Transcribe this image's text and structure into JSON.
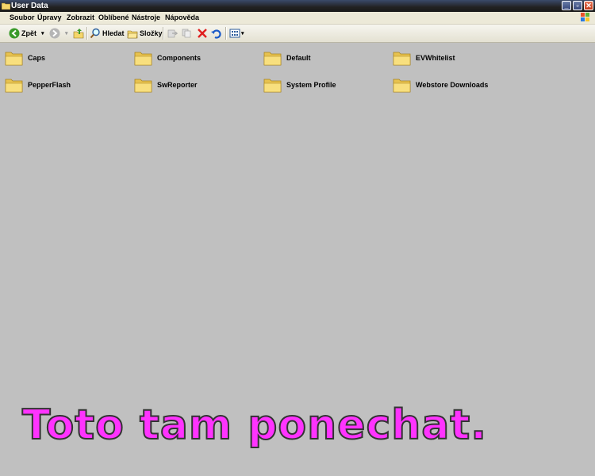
{
  "window": {
    "title": "User Data"
  },
  "menu": [
    "Soubor",
    "Úpravy",
    "Zobrazit",
    "Oblíbené",
    "Nástroje",
    "Nápověda"
  ],
  "toolbar": {
    "back_label": "Zpět",
    "search_label": "Hledat",
    "folders_label": "Složky"
  },
  "folders": [
    {
      "name": "Caps"
    },
    {
      "name": "Components"
    },
    {
      "name": "Default"
    },
    {
      "name": "EVWhitelist"
    },
    {
      "name": "PepperFlash"
    },
    {
      "name": "SwReporter"
    },
    {
      "name": "System Profile"
    },
    {
      "name": "Webstore Downloads"
    }
  ],
  "annotation": {
    "text": "Toto tam ponechat.",
    "color": "#ff33ff"
  },
  "colors": {
    "background": "#c0c0c0",
    "folder": "#f5d66b",
    "close_button": "#d24b2a"
  }
}
